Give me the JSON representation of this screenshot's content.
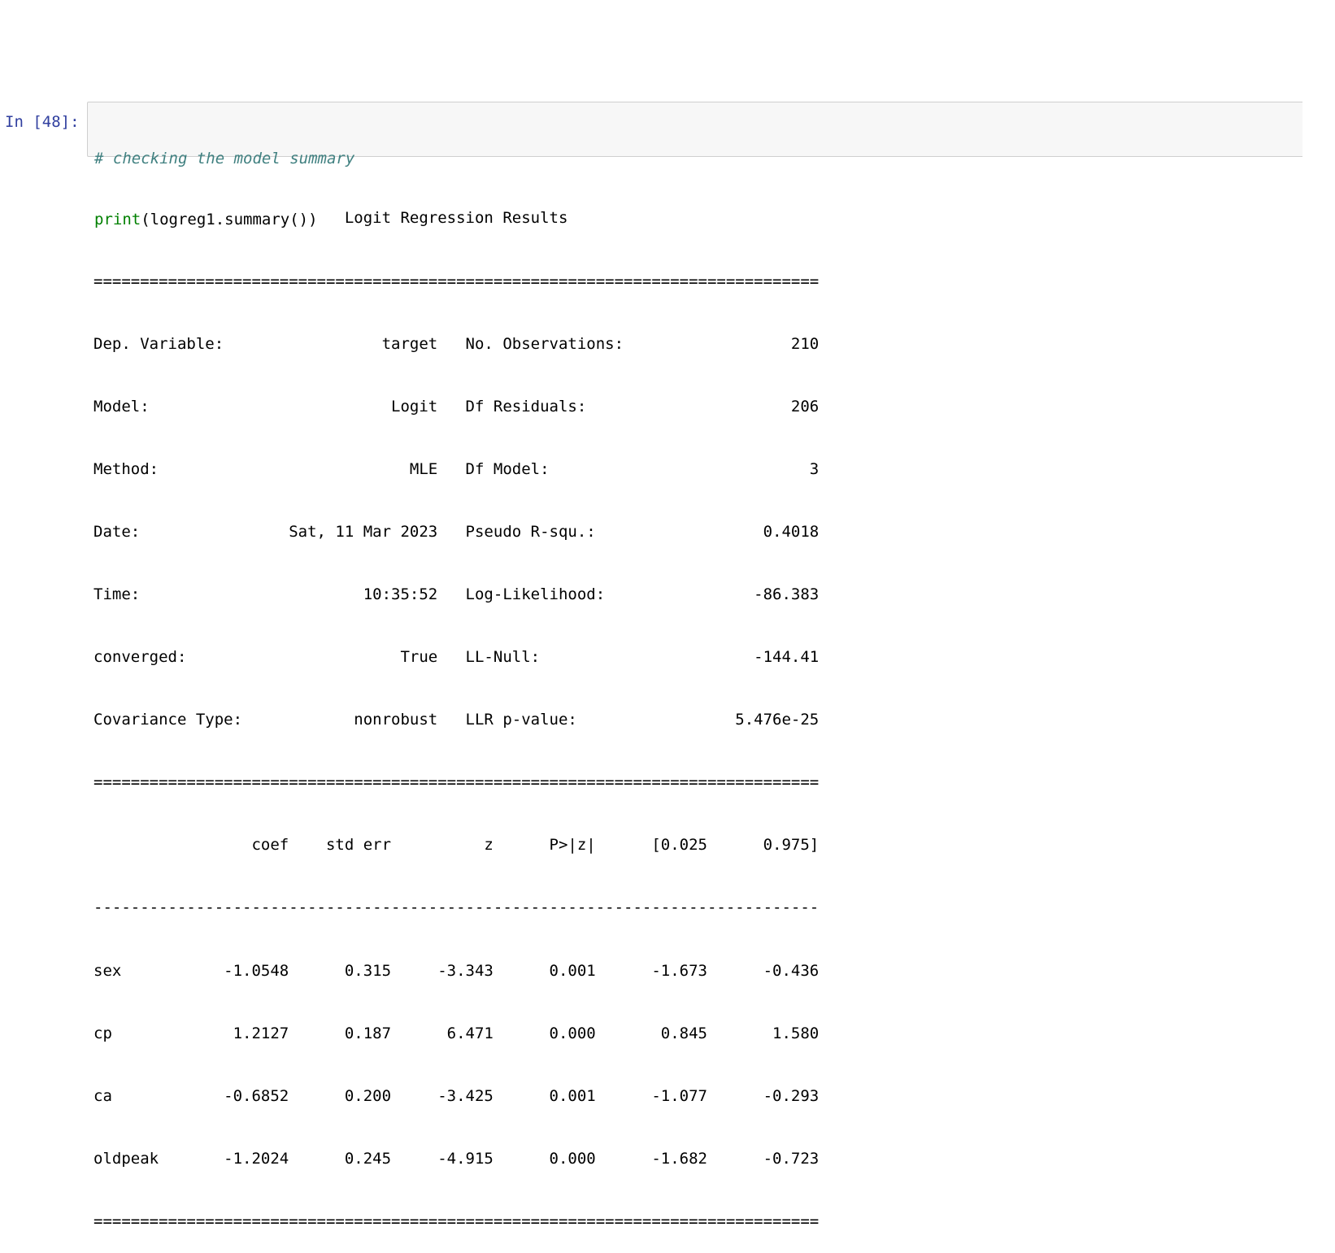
{
  "cell": {
    "prompt": "In [48]:",
    "code": {
      "comment": "# checking the model summary",
      "builtin": "print",
      "rest": "(logreg1.summary())"
    }
  },
  "output": {
    "title": "                           Logit Regression Results                           ",
    "separator_double": "==============================================================================",
    "separator_single": "------------------------------------------------------------------------------",
    "info_rows": [
      "Dep. Variable:                 target   No. Observations:                  210",
      "Model:                          Logit   Df Residuals:                      206",
      "Method:                           MLE   Df Model:                            3",
      "Date:                Sat, 11 Mar 2023   Pseudo R-squ.:                  0.4018",
      "Time:                        10:35:52   Log-Likelihood:                -86.383",
      "converged:                       True   LL-Null:                       -144.41",
      "Covariance Type:            nonrobust   LLR p-value:                 5.476e-25"
    ],
    "coef_header": "                 coef    std err          z      P>|z|      [0.025      0.975]",
    "coef_rows": [
      "sex           -1.0548      0.315     -3.343      0.001      -1.673      -0.436",
      "cp             1.2127      0.187      6.471      0.000       0.845       1.580",
      "ca            -0.6852      0.200     -3.425      0.001      -1.077      -0.293",
      "oldpeak       -1.2024      0.245     -4.915      0.000      -1.682      -0.723"
    ]
  },
  "colors": {
    "prompt": "#303f9f",
    "comment": "#408080",
    "builtin": "#008000",
    "cell_bg": "#f7f7f7",
    "cell_border": "#cfcfcf"
  }
}
